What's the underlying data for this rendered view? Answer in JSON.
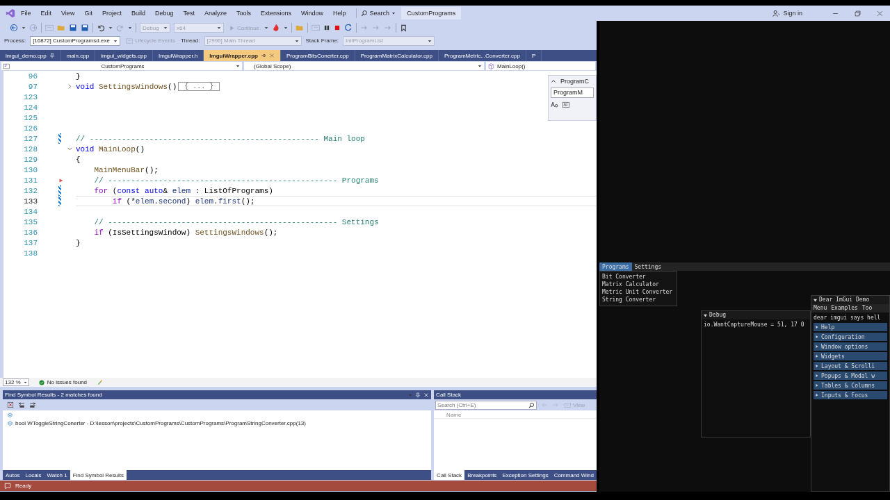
{
  "title_bar": {
    "menus": [
      "File",
      "Edit",
      "View",
      "Git",
      "Project",
      "Build",
      "Debug",
      "Test",
      "Analyze",
      "Tools",
      "Extensions",
      "Window",
      "Help"
    ],
    "search": "Search",
    "solution": "CustomPrograms",
    "sign_in": "Sign in"
  },
  "toolbar": {
    "configuration": {
      "value": "Debug",
      "disabled": true
    },
    "platform": {
      "value": "x64",
      "disabled": true
    },
    "continue": "Continue"
  },
  "debug_location": [
    {
      "kind": "label",
      "text": "Process:",
      "disabled": false
    },
    {
      "kind": "combo",
      "text": "[16872] CustomProgramsd.exe",
      "disabled": false
    },
    {
      "kind": "button",
      "text": "Lifecycle Events",
      "disabled": true
    },
    {
      "kind": "label",
      "text": "Thread:",
      "disabled": false
    },
    {
      "kind": "combo",
      "text": "[2996] Main Thread",
      "disabled": true
    },
    {
      "kind": "label",
      "text": "Stack Frame:",
      "disabled": false
    },
    {
      "kind": "combo",
      "text": "InitProgramList",
      "disabled": true
    }
  ],
  "tabs": [
    {
      "label": "imgui_demo.cpp",
      "selected": false,
      "pinned": true
    },
    {
      "label": "main.cpp",
      "selected": false,
      "pinned": false
    },
    {
      "label": "imgui_widgets.cpp",
      "selected": false,
      "pinned": false
    },
    {
      "label": "ImguiWrapper.h",
      "selected": false,
      "pinned": false
    },
    {
      "label": "ImguiWrapper.cpp",
      "selected": true,
      "pinned": false
    },
    {
      "label": "ProgramBitsConerter.cpp",
      "selected": false,
      "pinned": false
    },
    {
      "label": "ProgramMatrixCalculator.cpp",
      "selected": false,
      "pinned": false
    },
    {
      "label": "ProgramMetric...Converter.cpp",
      "selected": false,
      "pinned": false
    },
    {
      "label": "P",
      "selected": false,
      "pinned": false
    }
  ],
  "nav_bar": {
    "project": "CustomPrograms",
    "scope": "(Global Scope)",
    "member": "MainLoop()"
  },
  "editor": {
    "lines": [
      {
        "number": "96",
        "current": false,
        "segments": [
          {
            "kind": "plain",
            "text": "}"
          }
        ]
      },
      {
        "number": "97",
        "expanded": false,
        "current": false,
        "segments": [
          {
            "kind": "kw",
            "text": "void "
          },
          {
            "kind": "fn",
            "text": "SettingsWindows"
          },
          {
            "kind": "plain",
            "text": "()"
          },
          {
            "kind": "collapsed",
            "text": "{ ... }"
          }
        ]
      },
      {
        "number": "123",
        "current": false
      },
      {
        "number": "124",
        "current": false
      },
      {
        "number": "125",
        "current": false
      },
      {
        "number": "126",
        "current": false
      },
      {
        "number": "127",
        "changed": true,
        "current": false,
        "segments": [
          {
            "kind": "cm",
            "text": "// -------------------------------------------------- Main loop"
          }
        ]
      },
      {
        "number": "128",
        "expanded": true,
        "current": false,
        "segments": [
          {
            "kind": "kw",
            "text": "void "
          },
          {
            "kind": "fn",
            "text": "MainLoop"
          },
          {
            "kind": "plain",
            "text": "()"
          }
        ]
      },
      {
        "number": "129",
        "current": false,
        "segments": [
          {
            "kind": "plain",
            "text": "{"
          }
        ]
      },
      {
        "number": "130",
        "current": false,
        "segments": [
          {
            "kind": "fn",
            "text": "    MainMenuBar"
          },
          {
            "kind": "plain",
            "text": "();"
          }
        ]
      },
      {
        "number": "131",
        "breakpoint_arrow": true,
        "current": false,
        "segments": [
          {
            "kind": "cm",
            "text": "    // -------------------------------------------------- Programs"
          }
        ]
      },
      {
        "number": "132",
        "changed": true,
        "current": false,
        "segments": [
          {
            "kind": "ctl",
            "text": "    for"
          },
          {
            "kind": "plain",
            "text": " ("
          },
          {
            "kind": "kw",
            "text": "const auto"
          },
          {
            "kind": "plain",
            "text": "& "
          },
          {
            "kind": "var",
            "text": "elem"
          },
          {
            "kind": "plain",
            "text": " : ListOfPrograms)"
          }
        ]
      },
      {
        "number": "133",
        "changed": true,
        "current": true,
        "segments": [
          {
            "kind": "ctl",
            "text": "        if"
          },
          {
            "kind": "plain",
            "text": " (*"
          },
          {
            "kind": "var",
            "text": "elem"
          },
          {
            "kind": "plain",
            "text": "."
          },
          {
            "kind": "var",
            "text": "second"
          },
          {
            "kind": "plain",
            "text": ") "
          },
          {
            "kind": "var",
            "text": "elem"
          },
          {
            "kind": "plain",
            "text": "."
          },
          {
            "kind": "var",
            "text": "first"
          },
          {
            "kind": "plain",
            "text": "();"
          }
        ]
      },
      {
        "number": "134",
        "current": false
      },
      {
        "number": "135",
        "current": false,
        "segments": [
          {
            "kind": "cm",
            "text": "    // -------------------------------------------------- Settings"
          }
        ]
      },
      {
        "number": "136",
        "current": false,
        "segments": [
          {
            "kind": "ctl",
            "text": "    if"
          },
          {
            "kind": "plain",
            "text": " (IsSettingsWindow) "
          },
          {
            "kind": "fn",
            "text": "SettingsWindows"
          },
          {
            "kind": "plain",
            "text": "();"
          }
        ]
      },
      {
        "number": "137",
        "current": false,
        "segments": [
          {
            "kind": "plain",
            "text": "}"
          }
        ]
      },
      {
        "number": "138",
        "current": false
      }
    ],
    "find_widget": {
      "find_text": "ProgramC",
      "replace_text": "ProgramM"
    }
  },
  "editor_status": {
    "zoom": "132 %",
    "issues": "No issues found"
  },
  "find_symbol_panel": {
    "title": "Find Symbol Results - 2 matches found",
    "results": [
      {
        "kind": "group"
      },
      {
        "kind": "match",
        "text": "bool WToggleStringConerter - D:\\lesson\\projects\\CustomPrograms\\CustomPrograms\\ProgramStringConverter.cpp(13)"
      }
    ],
    "tabs": [
      {
        "label": "Autos",
        "selected": false
      },
      {
        "label": "Locals",
        "selected": false
      },
      {
        "label": "Watch 1",
        "selected": false
      },
      {
        "label": "Find Symbol Results",
        "selected": true
      }
    ]
  },
  "call_stack_panel": {
    "title": "Call Stack",
    "search_placeholder": "Search (Ctrl+E)",
    "view_button": "View",
    "column": "Name",
    "tabs": [
      {
        "label": "Call Stack",
        "selected": true
      },
      {
        "label": "Breakpoints",
        "selected": false
      },
      {
        "label": "Exception Settings",
        "selected": false
      },
      {
        "label": "Command Wind",
        "selected": false
      }
    ]
  },
  "status_bar": {
    "text": "Ready"
  },
  "app": {
    "menus": [
      {
        "label": "Programs",
        "selected": true
      },
      {
        "label": "Settings",
        "selected": false
      }
    ],
    "menu_items": [
      "Bit Converter",
      "Matrix Calculator",
      "Metric Unit Converter",
      "String Converter"
    ],
    "debug_window": {
      "title": "Debug",
      "text": "io.WantCaptureMouse = 51, 17 0"
    },
    "demo_window": {
      "title": "Dear ImGui Demo",
      "menus": [
        "Menu",
        "Examples",
        "Too"
      ],
      "text": "dear imgui says hell",
      "headers": [
        "Help",
        "Configuration",
        "Window options",
        "Widgets",
        "Layout & Scrolli",
        "Popups & Modal w",
        "Tables & Columns",
        "Inputs & Focus"
      ]
    }
  }
}
